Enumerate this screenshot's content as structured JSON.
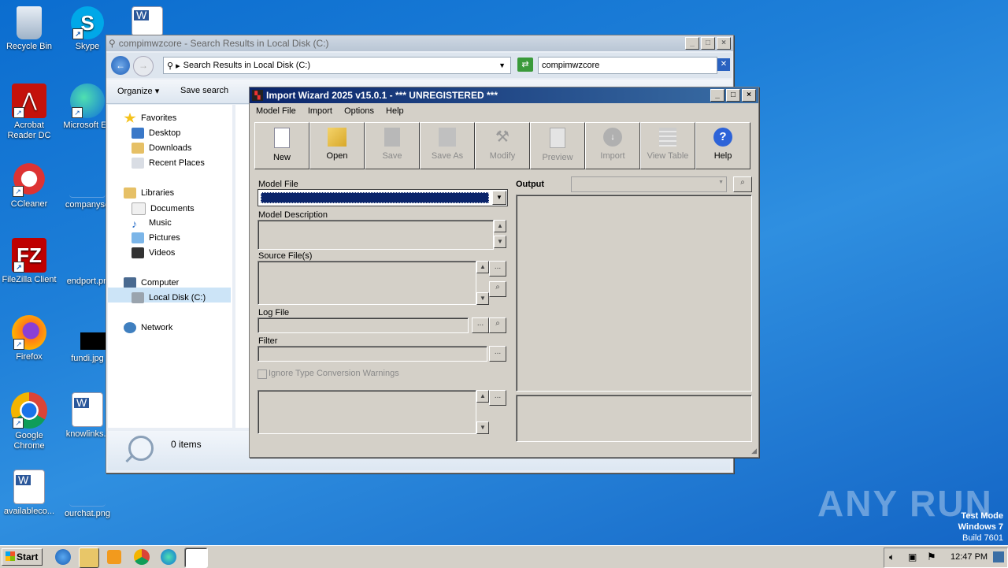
{
  "desktop": {
    "icons": [
      {
        "label": "Recycle Bin"
      },
      {
        "label": "Skype"
      },
      {
        "label": "Acrobat Reader DC"
      },
      {
        "label": "Microsoft Ed"
      },
      {
        "label": "CCleaner"
      },
      {
        "label": "companyso"
      },
      {
        "label": "FileZilla Client"
      },
      {
        "label": "endport.pn"
      },
      {
        "label": "Firefox"
      },
      {
        "label": "fundi.jpg"
      },
      {
        "label": "Google Chrome"
      },
      {
        "label": "knowlinks.r"
      },
      {
        "label": "availableco..."
      },
      {
        "label": "ourchat.png"
      }
    ],
    "watermark": "ANY RUN",
    "test_mode": {
      "line1": "Test Mode",
      "line2": "Windows 7",
      "line3": "Build 7601"
    }
  },
  "explorer": {
    "title": "compimwzcore - Search Results in Local Disk (C:)",
    "address": "Search Results in Local Disk (C:)",
    "search_value": "compimwzcore",
    "toolbar": {
      "organize": "Organize",
      "save_search": "Save search"
    },
    "nav": {
      "favorites": "Favorites",
      "desktop": "Desktop",
      "downloads": "Downloads",
      "recent": "Recent Places",
      "libraries": "Libraries",
      "documents": "Documents",
      "music": "Music",
      "pictures": "Pictures",
      "videos": "Videos",
      "computer": "Computer",
      "local_disk": "Local Disk (C:)",
      "network": "Network"
    },
    "status": "0 items"
  },
  "wizard": {
    "title": "Import Wizard 2025 v15.0.1 - *** UNREGISTERED ***",
    "menu": [
      "Model File",
      "Import",
      "Options",
      "Help"
    ],
    "tools": [
      {
        "label": "New",
        "icon": "new-file-icon",
        "enabled": true
      },
      {
        "label": "Open",
        "icon": "open-folder-icon",
        "enabled": true
      },
      {
        "label": "Save",
        "icon": "save-icon",
        "enabled": false
      },
      {
        "label": "Save As",
        "icon": "save-as-icon",
        "enabled": false
      },
      {
        "label": "Modify",
        "icon": "tools-icon",
        "enabled": false
      },
      {
        "label": "Preview",
        "icon": "preview-icon",
        "enabled": false
      },
      {
        "label": "Import",
        "icon": "import-icon",
        "enabled": false
      },
      {
        "label": "View Table",
        "icon": "table-icon",
        "enabled": false
      },
      {
        "label": "Help",
        "icon": "help-icon",
        "enabled": true
      }
    ],
    "fields": {
      "model_file": "Model File",
      "model_description": "Model Description",
      "source_files": "Source File(s)",
      "log_file": "Log File",
      "filter": "Filter",
      "ignore_warnings": "Ignore Type Conversion Warnings",
      "output": "Output",
      "ellipsis": "..."
    }
  },
  "taskbar": {
    "start": "Start",
    "time": "12:47 PM"
  },
  "colors": {
    "selection": "#0a246a",
    "titlebar_active": "#0a246a",
    "desktop_blue": "#1e7fd8"
  }
}
